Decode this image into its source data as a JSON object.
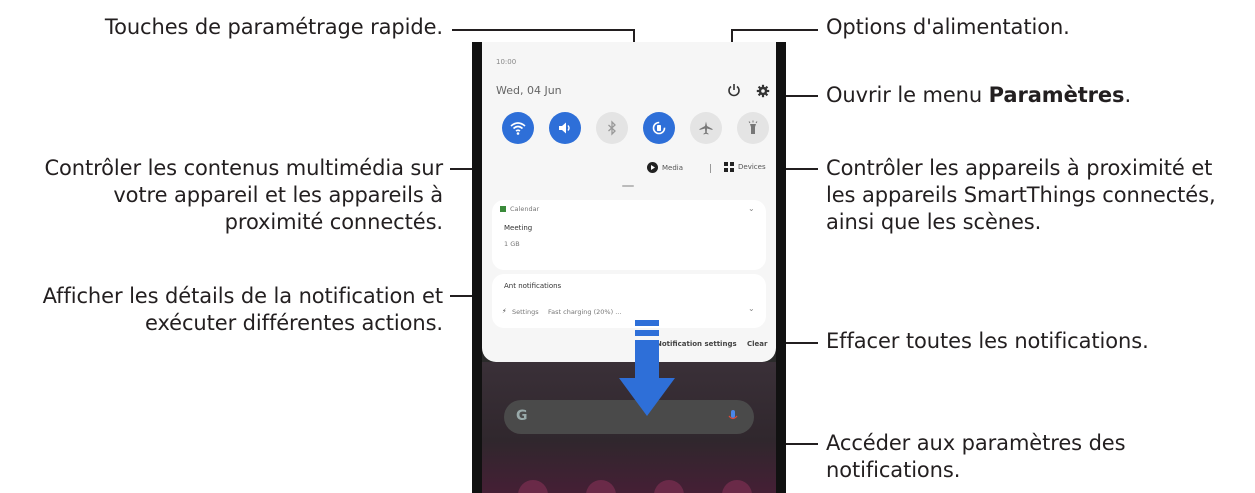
{
  "callouts": {
    "quick_settings": "Touches de paramétrage rapide.",
    "power_options": "Options d'alimentation.",
    "open_settings_prefix": "Ouvrir le menu ",
    "open_settings_bold": "Paramètres",
    "open_settings_suffix": ".",
    "media_line1": "Contrôler les contenus multimédia sur",
    "media_line2": "votre appareil et les appareils à",
    "media_line3": "proximité connectés.",
    "devices_line1": "Contrôler les appareils à proximité et",
    "devices_line2": "les appareils SmartThings connectés,",
    "devices_line3": "ainsi que les scènes.",
    "notif_details_line1": "Afficher les détails de la notification et",
    "notif_details_line2": "exécuter différentes actions.",
    "clear_all": "Effacer toutes les notifications.",
    "notif_settings_line1": "Accéder aux paramètres des",
    "notif_settings_line2": "notifications."
  },
  "phone": {
    "time": "10:00",
    "date": "Wed, 04 Jun",
    "media_label": "Media",
    "devices_label": "Devices",
    "card1": {
      "app": "Calendar",
      "title": "Meeting",
      "sub": "1 GB"
    },
    "card2": {
      "header": "Ant notifications",
      "app": "Settings",
      "text": "Fast charging (20%) ..."
    },
    "notification_settings": "Notification settings",
    "clear": "Clear"
  },
  "colors": {
    "accent": "#2e6fd8",
    "leader": "#231f20"
  },
  "icons": [
    "wifi-icon",
    "volume-icon",
    "bluetooth-icon",
    "auto-rotate-icon",
    "airplane-icon",
    "flashlight-icon",
    "power-icon",
    "gear-icon",
    "play-icon",
    "devices-icon"
  ]
}
